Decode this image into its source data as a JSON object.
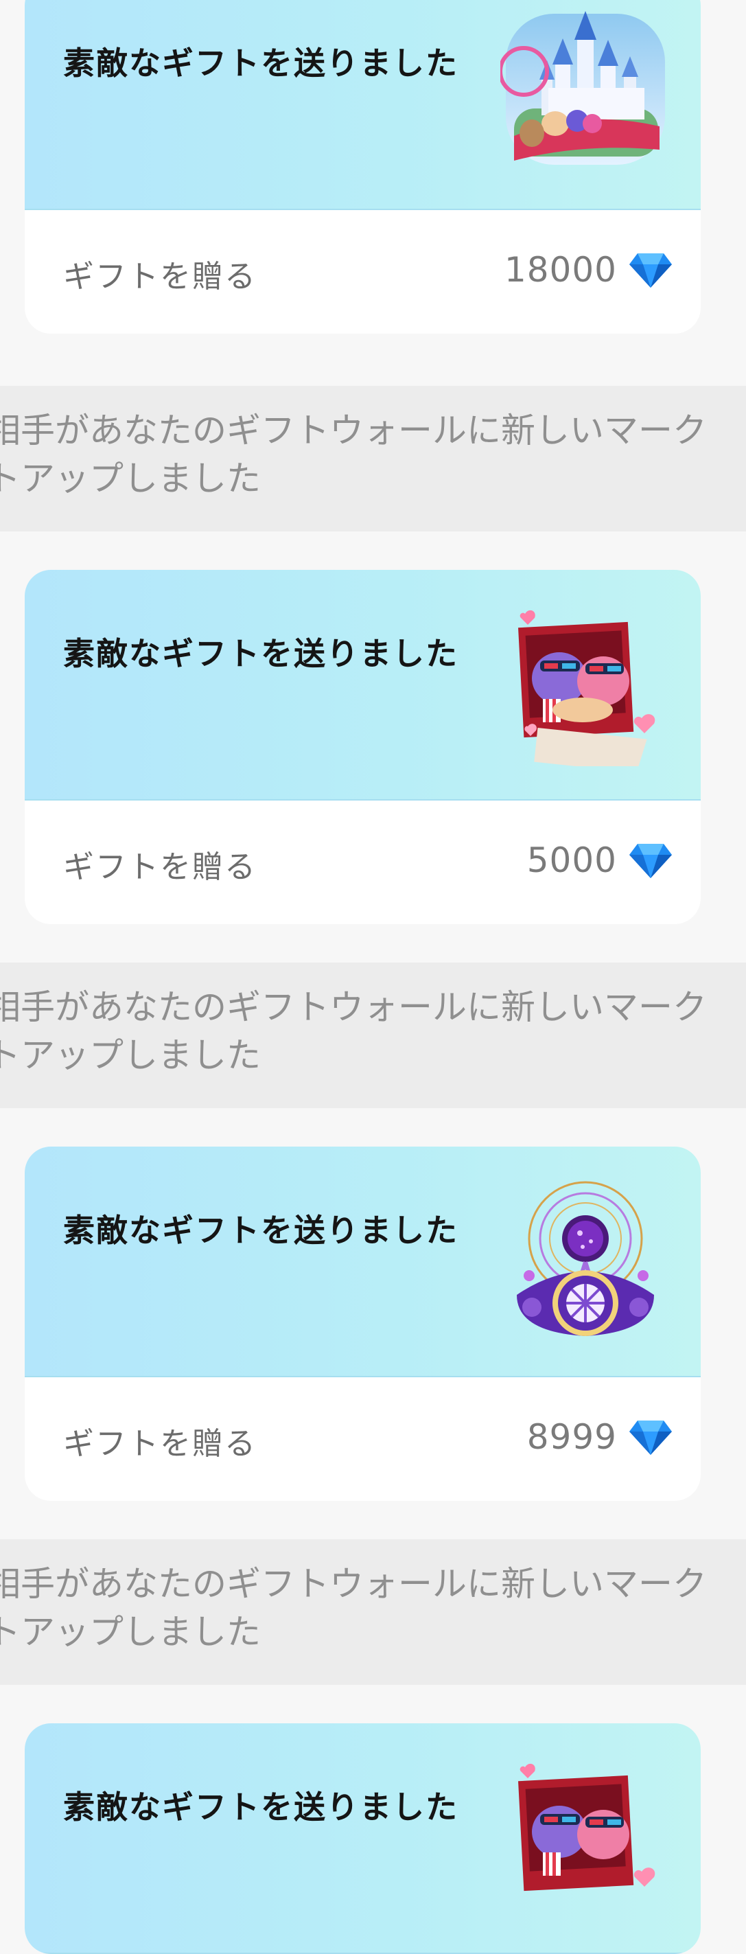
{
  "feed": {
    "cards": [
      {
        "title": "素敵なギフトを送りました",
        "send_label": "ギフトを贈る",
        "price": "18000",
        "gift_icon": "castle-gift-icon"
      },
      {
        "title": "素敵なギフトを送りました",
        "send_label": "ギフトを贈る",
        "price": "5000",
        "gift_icon": "movie-date-gift-icon"
      },
      {
        "title": "素敵なギフトを送りました",
        "send_label": "ギフトを贈る",
        "price": "8999",
        "gift_icon": "ferris-wheel-gift-icon"
      },
      {
        "title": "素敵なギフトを送りました",
        "gift_icon": "movie-date-gift-icon"
      }
    ],
    "notices": [
      {
        "line1": "相手があなたのギフトウォールに新しいマーク",
        "line2": "トアップしました"
      },
      {
        "line1": "相手があなたのギフトウォールに新しいマーク",
        "line2": "トアップしました"
      },
      {
        "line1": "相手があなたのギフトウォールに新しいマーク",
        "line2": "トアップしました"
      }
    ]
  },
  "colors": {
    "card_gradient_start": "#b3e6fb",
    "card_gradient_end": "#c2f4f3",
    "diamond": "#1e90ff",
    "notice_bg": "#ececec",
    "page_bg": "#f7f7f7"
  }
}
